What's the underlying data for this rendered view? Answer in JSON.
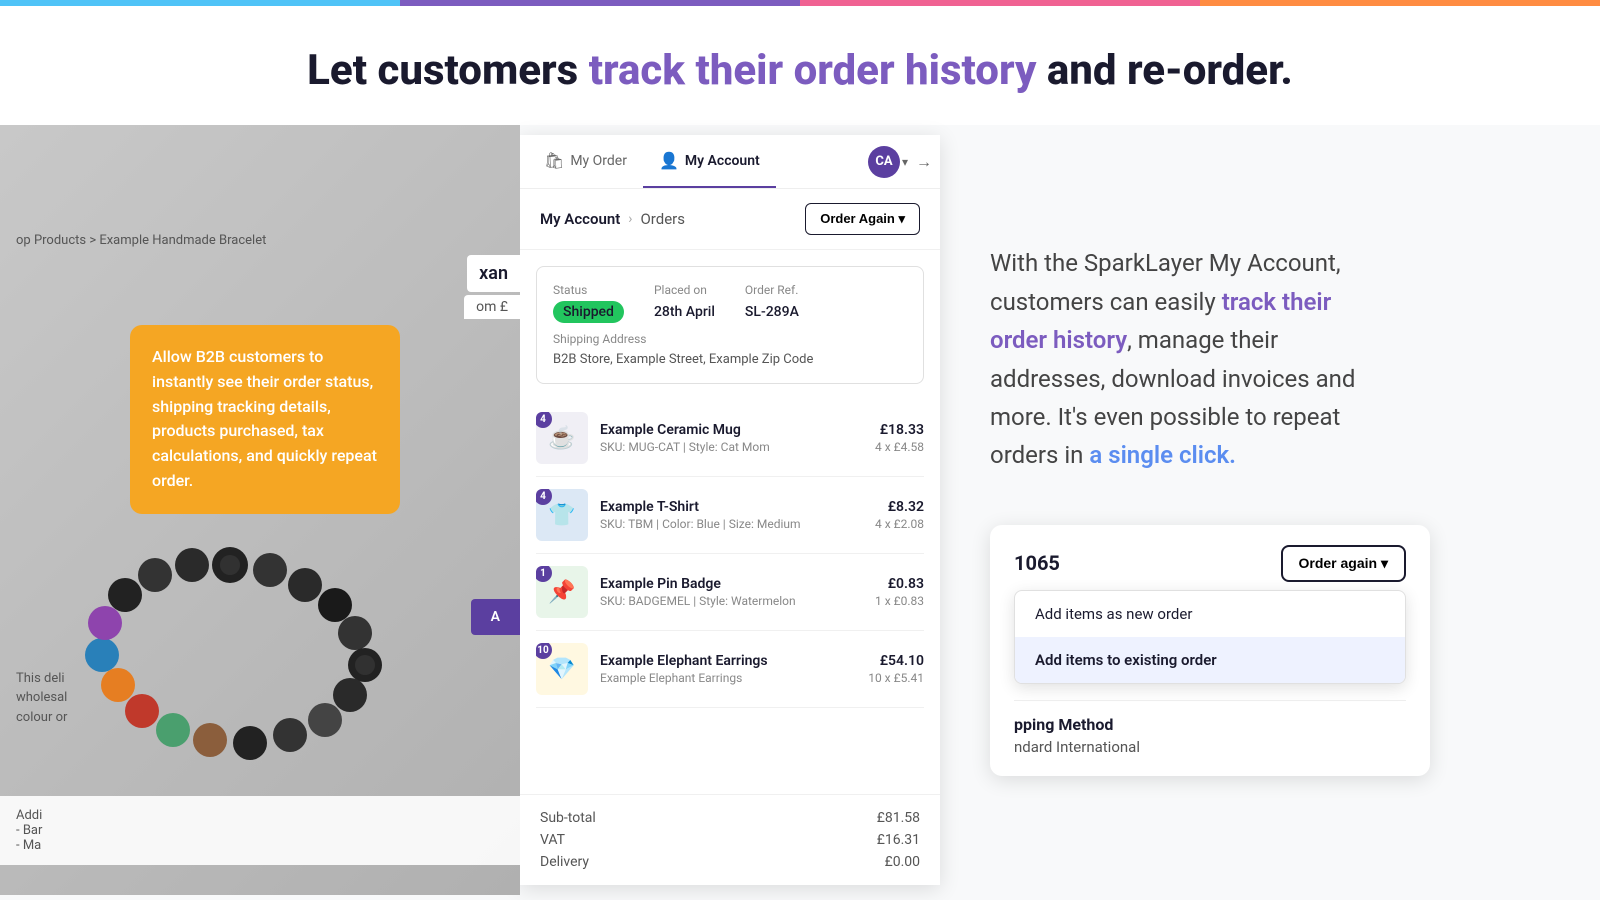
{
  "topBar": {
    "segments": [
      "#4fc3f7",
      "#7c5cbf",
      "#f06292",
      "#ff8c42"
    ]
  },
  "heading": {
    "prefix": "Let customers ",
    "highlight": "track their order history",
    "suffix": " and re-order."
  },
  "tooltip": {
    "text": "Allow B2B customers to instantly see their order status, shipping tracking details, products purchased, tax calculations, and quickly repeat order."
  },
  "breadcrumbLeft": "op Products > Example Handmade Bracelet",
  "productTitleOverlay": "xan",
  "priceOverlay": "om £",
  "addBtnLabel": "A",
  "descLeft1": "This deli",
  "descLeft2": "wholesal",
  "descLeft3": "colour or",
  "addOptionsLabel": "Addi",
  "addOptionsItems": [
    "- Bar",
    "- Ma"
  ],
  "tabs": {
    "myOrder": {
      "label": "My Order",
      "icon": "🛍"
    },
    "myAccount": {
      "label": "My Account",
      "icon": "👤"
    },
    "avatar": {
      "initials": "CA"
    }
  },
  "accountNav": {
    "breadcrumb": {
      "parent": "My Account",
      "separator": "›",
      "current": "Orders"
    },
    "orderAgainBtn": "Order Again ▾"
  },
  "orderCard": {
    "status": {
      "label": "Status",
      "value": "Shipped"
    },
    "placedOn": {
      "label": "Placed on",
      "value": "28th April"
    },
    "orderRef": {
      "label": "Order Ref.",
      "value": "SL-289A"
    },
    "shippingAddress": {
      "label": "Shipping Address",
      "value": "B2B Store, Example Street, Example Zip Code"
    }
  },
  "products": [
    {
      "qty": 4,
      "emoji": "☕",
      "name": "Example Ceramic Mug",
      "sku": "SKU: MUG-CAT | Style: Cat Mom",
      "total": "£18.33",
      "unit": "4 x £4.58"
    },
    {
      "qty": 4,
      "emoji": "👕",
      "name": "Example T-Shirt",
      "sku": "SKU: TBM | Color: Blue | Size: Medium",
      "total": "£8.32",
      "unit": "4 x £2.08"
    },
    {
      "qty": 1,
      "emoji": "📌",
      "name": "Example Pin Badge",
      "sku": "SKU: BADGEMEL | Style: Watermelon",
      "total": "£0.83",
      "unit": "1 x £0.83"
    },
    {
      "qty": 10,
      "emoji": "💎",
      "name": "Example Elephant Earrings",
      "sku": "Example Elephant Earrings",
      "total": "£54.10",
      "unit": "10 x £5.41"
    }
  ],
  "totals": {
    "subtotal": {
      "label": "Sub-total",
      "value": "£81.58"
    },
    "vat": {
      "label": "VAT",
      "value": "£16.31"
    },
    "delivery": {
      "label": "Delivery",
      "value": "£0.00"
    }
  },
  "rightPanel": {
    "description": {
      "part1": "With the SparkLayer My Account, customers can easily ",
      "highlight1": "track their order history",
      "part2": ", manage their addresses, download invoices and more. It's even possible to repeat orders in ",
      "highlight2": "a single click.",
      "part3": ""
    },
    "widget": {
      "orderNum": "1065",
      "orderAgainBtn": "Order again ▾",
      "dropdown": {
        "items": [
          {
            "label": "Add items as new order",
            "selected": false
          },
          {
            "label": "Add items to existing order",
            "selected": true
          }
        ]
      },
      "shipping": {
        "label": "pping Method",
        "value": "ndard International"
      }
    }
  }
}
